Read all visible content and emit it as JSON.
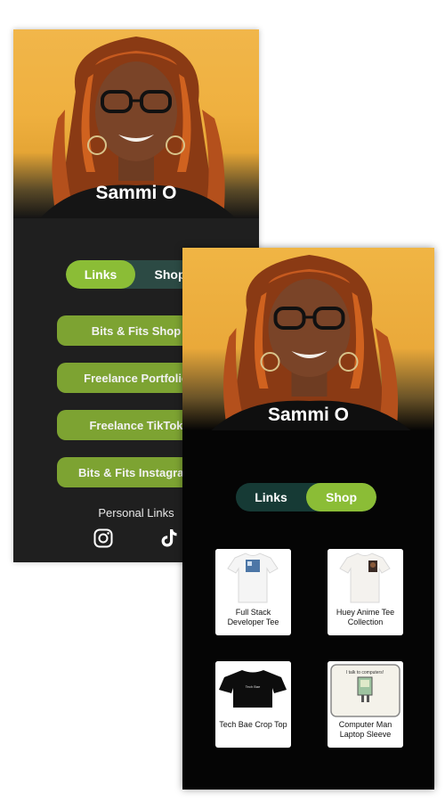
{
  "colors": {
    "accent_green": "#8bbd36",
    "button_green": "#7da332",
    "toggle_bg": "#2c4a44",
    "hero_gold": "#f0b544"
  },
  "links_screen": {
    "name": "Sammi O",
    "toggle": {
      "links": "Links",
      "shop": "Shop",
      "active": "links"
    },
    "buttons": [
      {
        "label": "Bits & Fits Shop"
      },
      {
        "label": "Freelance Portfolio"
      },
      {
        "label": "Freelance TikTok"
      },
      {
        "label": "Bits & Fits Instagram"
      }
    ],
    "personal_links_label": "Personal Links",
    "social": [
      {
        "icon": "instagram-icon"
      },
      {
        "icon": "tiktok-icon"
      }
    ]
  },
  "shop_screen": {
    "name": "Sammi O",
    "toggle": {
      "links": "Links",
      "shop": "Shop",
      "active": "shop"
    },
    "products": [
      {
        "name": "Full Stack Developer Tee"
      },
      {
        "name": "Huey Anime Tee Collection"
      },
      {
        "name": "Tech Bae Crop Top",
        "print": "Tech Bae"
      },
      {
        "name": "Computer Man Laptop Sleeve",
        "print": "I talk to computers!"
      }
    ]
  }
}
